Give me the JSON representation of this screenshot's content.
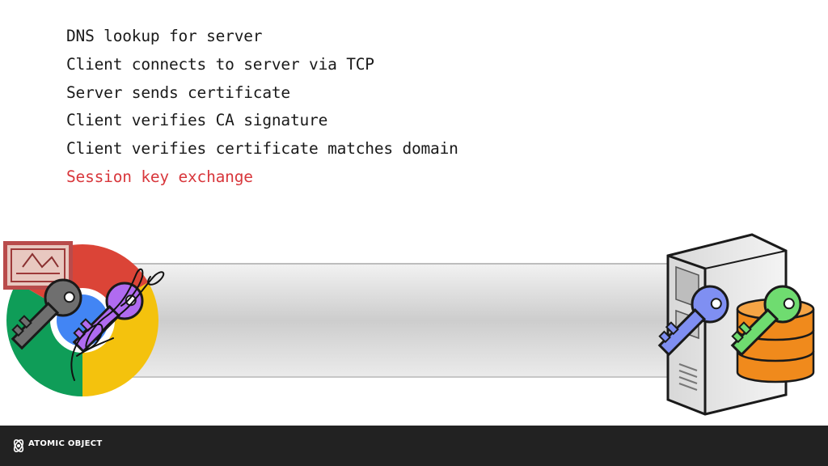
{
  "steps": [
    {
      "label": "DNS lookup for server",
      "active": false
    },
    {
      "label": "Client connects to server via TCP",
      "active": false
    },
    {
      "label": "Server sends certificate",
      "active": false
    },
    {
      "label": "Client verifies CA signature",
      "active": false
    },
    {
      "label": "Client verifies certificate matches domain",
      "active": false
    },
    {
      "label": "Session key exchange",
      "active": true
    }
  ],
  "colors": {
    "active_step": "#d8373c",
    "text": "#1a1a1a",
    "footer_bg": "#222222",
    "key_gray": "#6f6f6f",
    "key_purple": "#b06bf0",
    "key_blue": "#7f8ff2",
    "key_green": "#6fdc70",
    "database": "#f08a1c"
  },
  "icons": {
    "browser": "chrome-browser-icon",
    "stock_certificate": "stock-certificate-icon",
    "signature": "handwritten-signature-icon",
    "server": "server-tower-icon",
    "database": "database-icon"
  },
  "footer": {
    "brand_text": "ATOMIC OBJECT"
  }
}
